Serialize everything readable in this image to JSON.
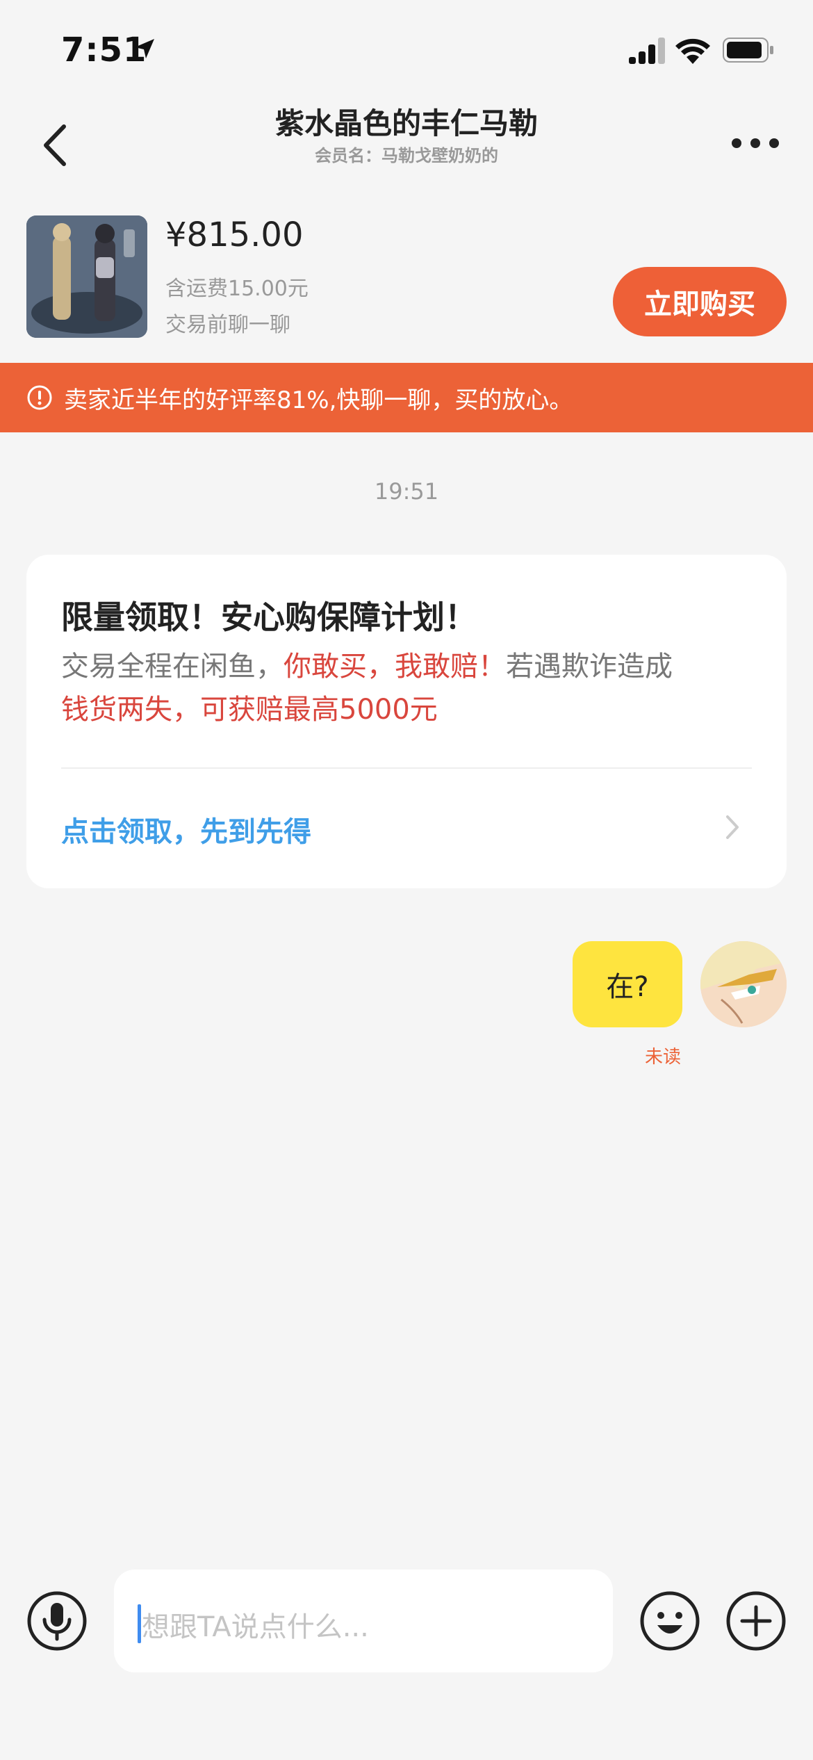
{
  "status_bar": {
    "time": "7:51",
    "icons": [
      "location-arrow-icon",
      "signal-icon",
      "wifi-icon",
      "battery-icon"
    ]
  },
  "header": {
    "title": "紫水晶色的丰仁马勒",
    "subtitle": "会员名：马勒戈壁奶奶的",
    "back_icon": "chevron-left-icon",
    "more_icon": "more-dots-icon"
  },
  "product": {
    "price": "¥815.00",
    "shipping": "含运费15.00元",
    "hint": "交易前聊一聊",
    "buy_label": "立即购买"
  },
  "banner": {
    "text": "卖家近半年的好评率81%,快聊一聊，买的放心。",
    "icon": "alert-circle-icon"
  },
  "chat": {
    "timestamp": "19:51",
    "promo_card": {
      "title": "限量领取！安心购保障计划！",
      "body_gray_1": "交易全程在闲鱼，",
      "body_red_1": "你敢买，我敢赔！",
      "body_gray_2": "若遇欺诈造成",
      "body_red_2": "钱货两失，可获赔最高5000元",
      "link": "点击领取，先到先得"
    },
    "messages": [
      {
        "from": "me",
        "text": "在?",
        "status": "未读"
      }
    ]
  },
  "input_bar": {
    "placeholder": "想跟TA说点什么...",
    "icons": [
      "microphone-icon",
      "emoji-icon",
      "plus-icon"
    ]
  },
  "colors": {
    "accent": "#ec6237",
    "link": "#3f9ee8",
    "bubble": "#fee43f",
    "warning_red": "#d9463d"
  }
}
